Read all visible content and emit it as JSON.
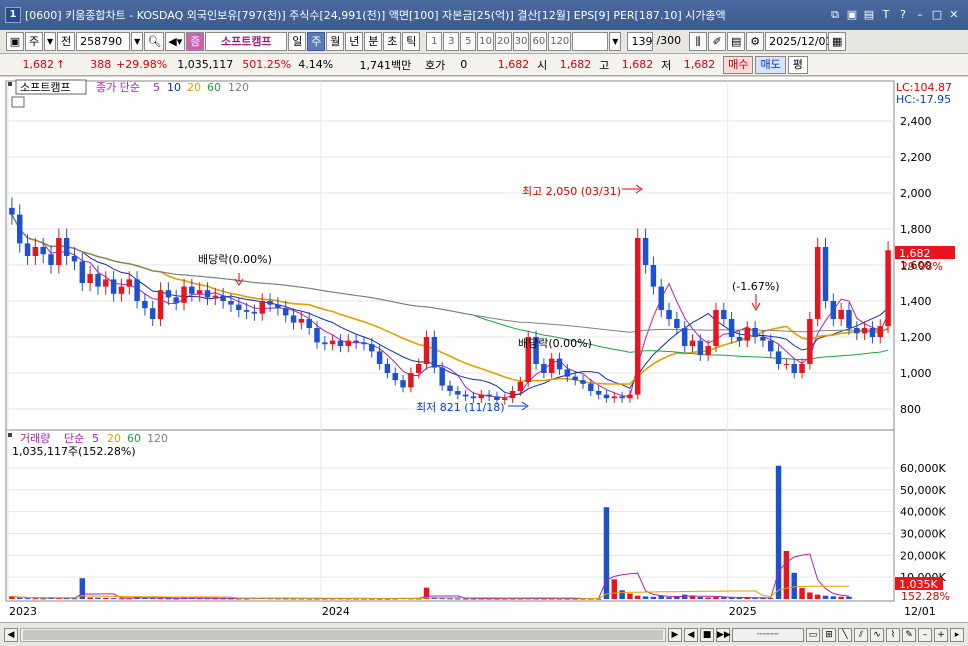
{
  "window": {
    "badge": "1",
    "title": "[0600] 키움종합차트 - KOSDAQ 외국인보유[797(천)] 주식수[24,991(천)] 액면[100] 자본금[25(억)] 결산[12월] EPS[9] PER[187.10] 시가총액"
  },
  "toolbar": {
    "period": "주",
    "prev_label": "전",
    "code": "258790",
    "stock_name": "소프트캠프",
    "timeframes": [
      "일",
      "주",
      "월",
      "년",
      "분",
      "초",
      "틱"
    ],
    "active_timeframe": "주",
    "minute_steps": [
      "1",
      "3",
      "5",
      "10",
      "20",
      "30",
      "60",
      "120"
    ],
    "count": "139",
    "total": "/300",
    "date": "2025/12/01"
  },
  "quote": {
    "price": "1,682",
    "arrow": "↑",
    "change": "388",
    "rate": "+29.98%",
    "volume": "1,035,117",
    "vol_ratio": "501.25%",
    "turnover": "4.14%",
    "amount": "1,741백만",
    "ask_label": "호가",
    "ask_value": "0",
    "close2": "1,682",
    "open_label": "시",
    "open": "1,682",
    "high_label": "고",
    "high": "1,682",
    "low_label": "저",
    "low": "1,682",
    "buy": "매수",
    "sell": "매도",
    "avg": "평"
  },
  "price_panel": {
    "stock_tab": "소프트캠프",
    "ma_title": "종가 단순",
    "ma_periods": [
      "5",
      "10",
      "20",
      "60",
      "120"
    ],
    "lc": "LC:104.87",
    "hc": "HC:-17.95",
    "annotations": {
      "high": "최고 2,050 (03/31)",
      "low": "최저 821 (11/18)",
      "div1": "배당락(0.00%)",
      "div2": "배당락(0.00%)",
      "pct": "(-1.67%)"
    },
    "current_price": "1,682",
    "current_rate": "29.98%"
  },
  "volume_panel": {
    "title": "거래량",
    "ma_title": "단순",
    "ma_periods": [
      "5",
      "20",
      "60",
      "120"
    ],
    "last": "1,035,117주(152.28%)",
    "current": "1,035K",
    "current_rate": "152.28%"
  },
  "x_axis": {
    "labels": [
      "2023",
      "2024",
      "2025"
    ],
    "last_date": "12/01"
  },
  "colors": {
    "up": "#e8141e",
    "down": "#1e50d2",
    "ma5": "#b020b0",
    "ma10": "#1030a0",
    "ma20": "#e0a000",
    "ma60": "#20a040",
    "ma120": "#808080",
    "accent": "#5a7ab8"
  },
  "chart_data": {
    "type": "candlestick",
    "frequency": "weekly",
    "x_range": [
      "2023-01",
      "2025-12-01"
    ],
    "price_ylim": [
      700,
      2600
    ],
    "price_ticks": [
      800,
      1000,
      1200,
      1400,
      1600,
      1800,
      2000,
      2200,
      2400
    ],
    "volume_ylim": [
      0,
      65000
    ],
    "volume_ticks": [
      "10,000K",
      "20,000K",
      "30,000K",
      "40,000K",
      "50,000K",
      "60,000K"
    ],
    "close_series": [
      1880,
      1720,
      1650,
      1700,
      1660,
      1600,
      1750,
      1650,
      1620,
      1500,
      1550,
      1480,
      1520,
      1440,
      1480,
      1520,
      1400,
      1360,
      1300,
      1460,
      1420,
      1390,
      1480,
      1440,
      1460,
      1420,
      1430,
      1400,
      1380,
      1350,
      1340,
      1330,
      1400,
      1380,
      1360,
      1320,
      1280,
      1300,
      1250,
      1170,
      1160,
      1180,
      1150,
      1180,
      1170,
      1160,
      1120,
      1050,
      1000,
      960,
      920,
      1000,
      1050,
      1200,
      1030,
      930,
      900,
      880,
      870,
      860,
      880,
      870,
      850,
      860,
      900,
      950,
      1200,
      1050,
      1000,
      1080,
      1020,
      980,
      960,
      940,
      900,
      880,
      860,
      870,
      860,
      880,
      1750,
      1600,
      1480,
      1350,
      1300,
      1250,
      1150,
      1180,
      1100,
      1150,
      1350,
      1300,
      1200,
      1180,
      1250,
      1200,
      1180,
      1120,
      1050,
      1050,
      1000,
      1050,
      1300,
      1700,
      1400,
      1300,
      1350,
      1250,
      1220,
      1250,
      1200,
      1260,
      1682
    ],
    "volume_series_k": [
      1200,
      600,
      400,
      350,
      300,
      900,
      500,
      400,
      350,
      9500,
      700,
      600,
      500,
      400,
      300,
      350,
      900,
      600,
      400,
      350,
      300,
      250,
      600,
      500,
      400,
      350,
      300,
      280,
      260,
      250,
      240,
      400,
      500,
      350,
      300,
      280,
      260,
      250,
      240,
      230,
      220,
      250,
      300,
      260,
      240,
      230,
      220,
      210,
      200,
      250,
      400,
      300,
      250,
      5200,
      800,
      400,
      300,
      250,
      220,
      200,
      220,
      210,
      200,
      210,
      230,
      250,
      300,
      260,
      240,
      230,
      220,
      210,
      200,
      220,
      210,
      200,
      42000,
      9000,
      4000,
      2500,
      1500,
      1200,
      1000,
      1500,
      800,
      1200,
      2000,
      1500,
      900,
      700,
      900,
      800,
      700,
      600,
      500,
      450,
      400,
      400,
      61000,
      22000,
      12000,
      5000,
      3000,
      2000,
      1500,
      1200,
      1000,
      1035
    ],
    "high": {
      "value": 2050,
      "date": "03/31"
    },
    "low": {
      "value": 821,
      "date": "11/18"
    }
  }
}
